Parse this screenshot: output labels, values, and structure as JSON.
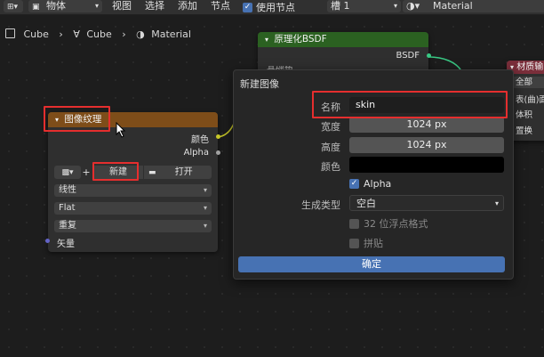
{
  "header": {
    "object_menu": "物体",
    "menus": [
      "视图",
      "选择",
      "添加",
      "节点"
    ],
    "use_nodes_label": "使用节点",
    "slot": "槽 1",
    "material_name": "Material"
  },
  "breadcrumb": {
    "items": [
      "Cube",
      "Cube",
      "Material"
    ]
  },
  "principled_node": {
    "title": "原理化BSDF",
    "output": "BSDF",
    "partial_text": "基础色"
  },
  "image_node": {
    "title": "图像纹理",
    "out_color": "颜色",
    "out_alpha": "Alpha",
    "new_button": "新建",
    "open_button": "打开",
    "interpolation": "线性",
    "projection": "Flat",
    "extension": "重复",
    "vector_label": "矢量"
  },
  "output_node": {
    "title": "材质输",
    "items": [
      "全部",
      "表(曲)面",
      "体积",
      "置换"
    ]
  },
  "popup": {
    "title": "新建图像",
    "name_label": "名称",
    "name_value": "skin",
    "width_label": "宽度",
    "width_value": "1024 px",
    "height_label": "高度",
    "height_value": "1024 px",
    "color_label": "颜色",
    "alpha_label": "Alpha",
    "gen_type_label": "生成类型",
    "gen_type_value": "空白",
    "float_label": "32 位浮点格式",
    "tiled_label": "拼贴",
    "ok_button": "确定"
  },
  "colors": {
    "accent": "#4772b3",
    "highlight": "#e52e2e",
    "image_node_header": "#7e4d19",
    "shader_node_header": "#2b6121"
  }
}
